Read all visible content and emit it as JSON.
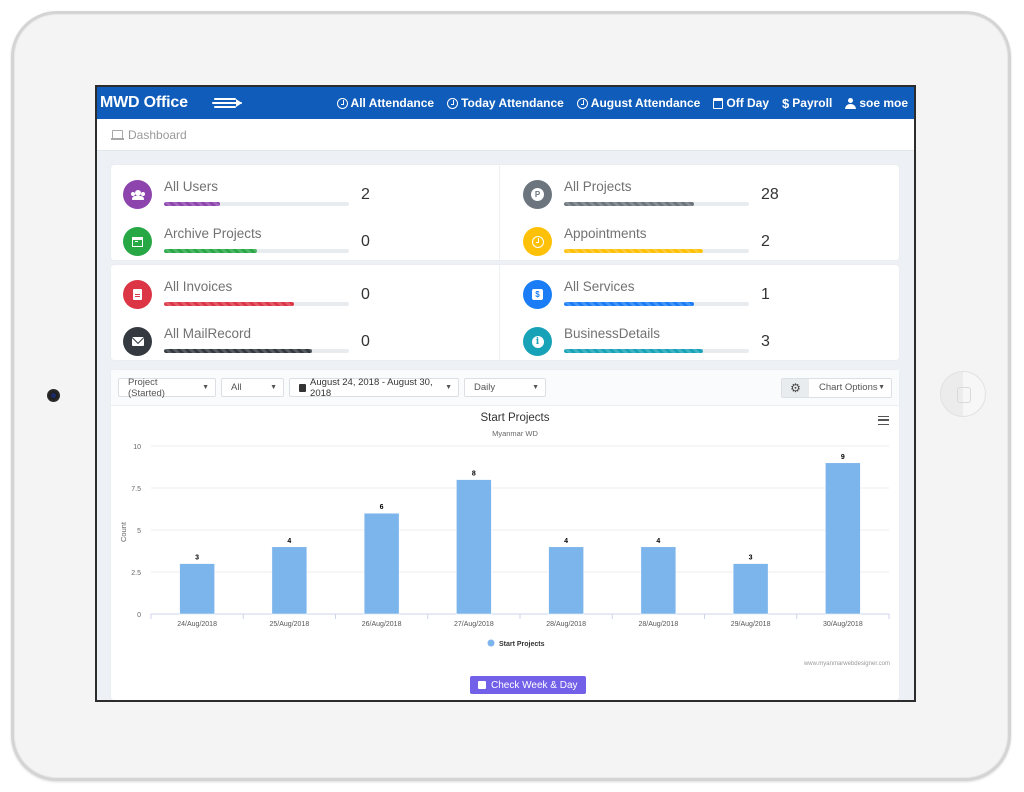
{
  "app": {
    "title": "MWD Office"
  },
  "nav": [
    {
      "icon": "clock-icon",
      "label": "All Attendance"
    },
    {
      "icon": "clock-icon",
      "label": "Today Attendance"
    },
    {
      "icon": "clock-icon",
      "label": "August Attendance"
    },
    {
      "icon": "calendar-icon",
      "label": "Off Day"
    },
    {
      "icon": "dollar-icon",
      "label": "Payroll"
    },
    {
      "icon": "user-icon",
      "label": "soe moe"
    }
  ],
  "breadcrumb": {
    "icon": "laptop-icon",
    "label": "Dashboard"
  },
  "stats": [
    {
      "label": "All Users",
      "value": "2",
      "icon": "users-icon",
      "color": "#8e44ad",
      "progress": 0.3
    },
    {
      "label": "Archive Projects",
      "value": "0",
      "icon": "archive-icon",
      "color": "#28a745",
      "progress": 0.5
    },
    {
      "label": "All Projects",
      "value": "28",
      "icon": "parking-icon",
      "color": "#6c757d",
      "progress": 0.7
    },
    {
      "label": "Appointments",
      "value": "2",
      "icon": "clock-icon",
      "color": "#ffc107",
      "progress": 0.75
    },
    {
      "label": "All Invoices",
      "value": "0",
      "icon": "invoice-icon",
      "color": "#dc3545",
      "progress": 0.7
    },
    {
      "label": "All MailRecord",
      "value": "0",
      "icon": "envelope-icon",
      "color": "#343a40",
      "progress": 0.8
    },
    {
      "label": "All Services",
      "value": "1",
      "icon": "dollar-box-icon",
      "color": "#1a7df5",
      "progress": 0.7
    },
    {
      "label": "BusinessDetails",
      "value": "3",
      "icon": "info-icon",
      "color": "#17a2b8",
      "progress": 0.75
    }
  ],
  "filters": {
    "type": "Project (Started)",
    "scope": "All",
    "date_range": "August 24, 2018 - August 30, 2018",
    "interval": "Daily",
    "chart_options": "Chart Options"
  },
  "check_button": "Check Week & Day",
  "credit": "www.myanmarwebdesigner.com",
  "chart_data": {
    "type": "bar",
    "title": "Start Projects",
    "subtitle": "Myanmar WD",
    "xlabel": "",
    "ylabel": "Count",
    "ylim": [
      0,
      10
    ],
    "yticks": [
      "0",
      "2.5",
      "5",
      "7.5",
      "10"
    ],
    "grid": true,
    "legend": "bottom-center",
    "color": "#7cb5ec",
    "categories": [
      "24/Aug/2018",
      "25/Aug/2018",
      "26/Aug/2018",
      "27/Aug/2018",
      "28/Aug/2018",
      "28/Aug/2018",
      "29/Aug/2018",
      "30/Aug/2018"
    ],
    "series": [
      {
        "name": "Start Projects",
        "values": [
          3,
          4,
          6,
          8,
          4,
          4,
          3,
          9
        ]
      }
    ]
  }
}
